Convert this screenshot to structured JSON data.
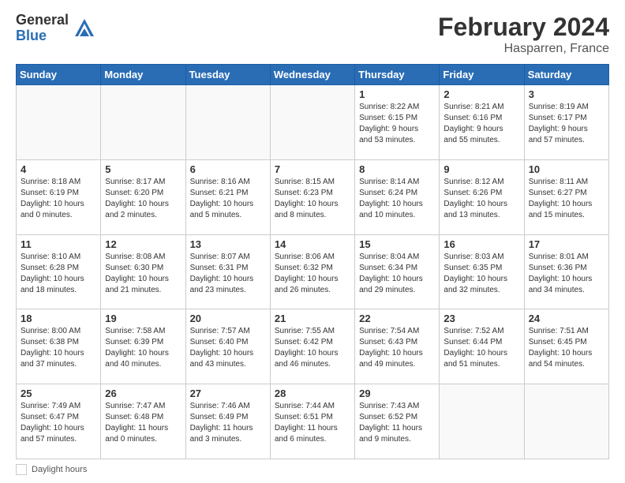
{
  "header": {
    "logo_general": "General",
    "logo_blue": "Blue",
    "title": "February 2024",
    "subtitle": "Hasparren, France"
  },
  "weekdays": [
    "Sunday",
    "Monday",
    "Tuesday",
    "Wednesday",
    "Thursday",
    "Friday",
    "Saturday"
  ],
  "weeks": [
    [
      {
        "day": "",
        "info": ""
      },
      {
        "day": "",
        "info": ""
      },
      {
        "day": "",
        "info": ""
      },
      {
        "day": "",
        "info": ""
      },
      {
        "day": "1",
        "info": "Sunrise: 8:22 AM\nSunset: 6:15 PM\nDaylight: 9 hours\nand 53 minutes."
      },
      {
        "day": "2",
        "info": "Sunrise: 8:21 AM\nSunset: 6:16 PM\nDaylight: 9 hours\nand 55 minutes."
      },
      {
        "day": "3",
        "info": "Sunrise: 8:19 AM\nSunset: 6:17 PM\nDaylight: 9 hours\nand 57 minutes."
      }
    ],
    [
      {
        "day": "4",
        "info": "Sunrise: 8:18 AM\nSunset: 6:19 PM\nDaylight: 10 hours\nand 0 minutes."
      },
      {
        "day": "5",
        "info": "Sunrise: 8:17 AM\nSunset: 6:20 PM\nDaylight: 10 hours\nand 2 minutes."
      },
      {
        "day": "6",
        "info": "Sunrise: 8:16 AM\nSunset: 6:21 PM\nDaylight: 10 hours\nand 5 minutes."
      },
      {
        "day": "7",
        "info": "Sunrise: 8:15 AM\nSunset: 6:23 PM\nDaylight: 10 hours\nand 8 minutes."
      },
      {
        "day": "8",
        "info": "Sunrise: 8:14 AM\nSunset: 6:24 PM\nDaylight: 10 hours\nand 10 minutes."
      },
      {
        "day": "9",
        "info": "Sunrise: 8:12 AM\nSunset: 6:26 PM\nDaylight: 10 hours\nand 13 minutes."
      },
      {
        "day": "10",
        "info": "Sunrise: 8:11 AM\nSunset: 6:27 PM\nDaylight: 10 hours\nand 15 minutes."
      }
    ],
    [
      {
        "day": "11",
        "info": "Sunrise: 8:10 AM\nSunset: 6:28 PM\nDaylight: 10 hours\nand 18 minutes."
      },
      {
        "day": "12",
        "info": "Sunrise: 8:08 AM\nSunset: 6:30 PM\nDaylight: 10 hours\nand 21 minutes."
      },
      {
        "day": "13",
        "info": "Sunrise: 8:07 AM\nSunset: 6:31 PM\nDaylight: 10 hours\nand 23 minutes."
      },
      {
        "day": "14",
        "info": "Sunrise: 8:06 AM\nSunset: 6:32 PM\nDaylight: 10 hours\nand 26 minutes."
      },
      {
        "day": "15",
        "info": "Sunrise: 8:04 AM\nSunset: 6:34 PM\nDaylight: 10 hours\nand 29 minutes."
      },
      {
        "day": "16",
        "info": "Sunrise: 8:03 AM\nSunset: 6:35 PM\nDaylight: 10 hours\nand 32 minutes."
      },
      {
        "day": "17",
        "info": "Sunrise: 8:01 AM\nSunset: 6:36 PM\nDaylight: 10 hours\nand 34 minutes."
      }
    ],
    [
      {
        "day": "18",
        "info": "Sunrise: 8:00 AM\nSunset: 6:38 PM\nDaylight: 10 hours\nand 37 minutes."
      },
      {
        "day": "19",
        "info": "Sunrise: 7:58 AM\nSunset: 6:39 PM\nDaylight: 10 hours\nand 40 minutes."
      },
      {
        "day": "20",
        "info": "Sunrise: 7:57 AM\nSunset: 6:40 PM\nDaylight: 10 hours\nand 43 minutes."
      },
      {
        "day": "21",
        "info": "Sunrise: 7:55 AM\nSunset: 6:42 PM\nDaylight: 10 hours\nand 46 minutes."
      },
      {
        "day": "22",
        "info": "Sunrise: 7:54 AM\nSunset: 6:43 PM\nDaylight: 10 hours\nand 49 minutes."
      },
      {
        "day": "23",
        "info": "Sunrise: 7:52 AM\nSunset: 6:44 PM\nDaylight: 10 hours\nand 51 minutes."
      },
      {
        "day": "24",
        "info": "Sunrise: 7:51 AM\nSunset: 6:45 PM\nDaylight: 10 hours\nand 54 minutes."
      }
    ],
    [
      {
        "day": "25",
        "info": "Sunrise: 7:49 AM\nSunset: 6:47 PM\nDaylight: 10 hours\nand 57 minutes."
      },
      {
        "day": "26",
        "info": "Sunrise: 7:47 AM\nSunset: 6:48 PM\nDaylight: 11 hours\nand 0 minutes."
      },
      {
        "day": "27",
        "info": "Sunrise: 7:46 AM\nSunset: 6:49 PM\nDaylight: 11 hours\nand 3 minutes."
      },
      {
        "day": "28",
        "info": "Sunrise: 7:44 AM\nSunset: 6:51 PM\nDaylight: 11 hours\nand 6 minutes."
      },
      {
        "day": "29",
        "info": "Sunrise: 7:43 AM\nSunset: 6:52 PM\nDaylight: 11 hours\nand 9 minutes."
      },
      {
        "day": "",
        "info": ""
      },
      {
        "day": "",
        "info": ""
      }
    ]
  ],
  "footer": {
    "label": "Daylight hours"
  }
}
